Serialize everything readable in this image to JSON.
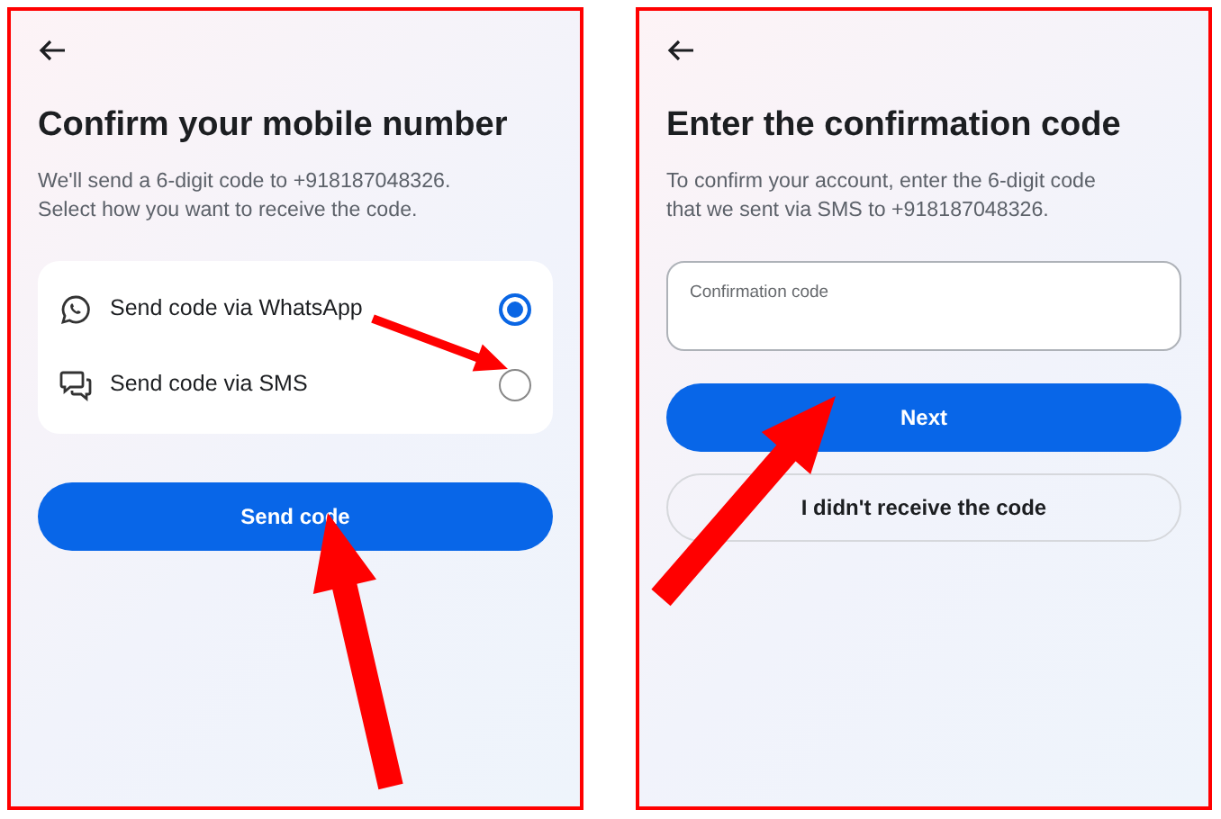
{
  "screens": [
    {
      "kind": "choose",
      "title": "Confirm your mobile number",
      "description": "We'll send a 6-digit code to +918187048326. Select how you want to receive the code.",
      "options": [
        {
          "kind": "whatsapp",
          "label": "Send code via WhatsApp",
          "selected": true
        },
        {
          "kind": "sms",
          "label": "Send code via SMS",
          "selected": false
        }
      ],
      "buttons": [
        {
          "kind": "primary",
          "label": "Send code"
        }
      ]
    },
    {
      "kind": "enter",
      "title": "Enter the confirmation code",
      "description": "To confirm your account, enter the 6-digit code that we sent via SMS to +918187048326.",
      "field": {
        "placeholder": "Confirmation code"
      },
      "buttons": [
        {
          "kind": "primary",
          "label": "Next"
        },
        {
          "kind": "outline",
          "label": "I didn't receive the code"
        }
      ]
    }
  ]
}
